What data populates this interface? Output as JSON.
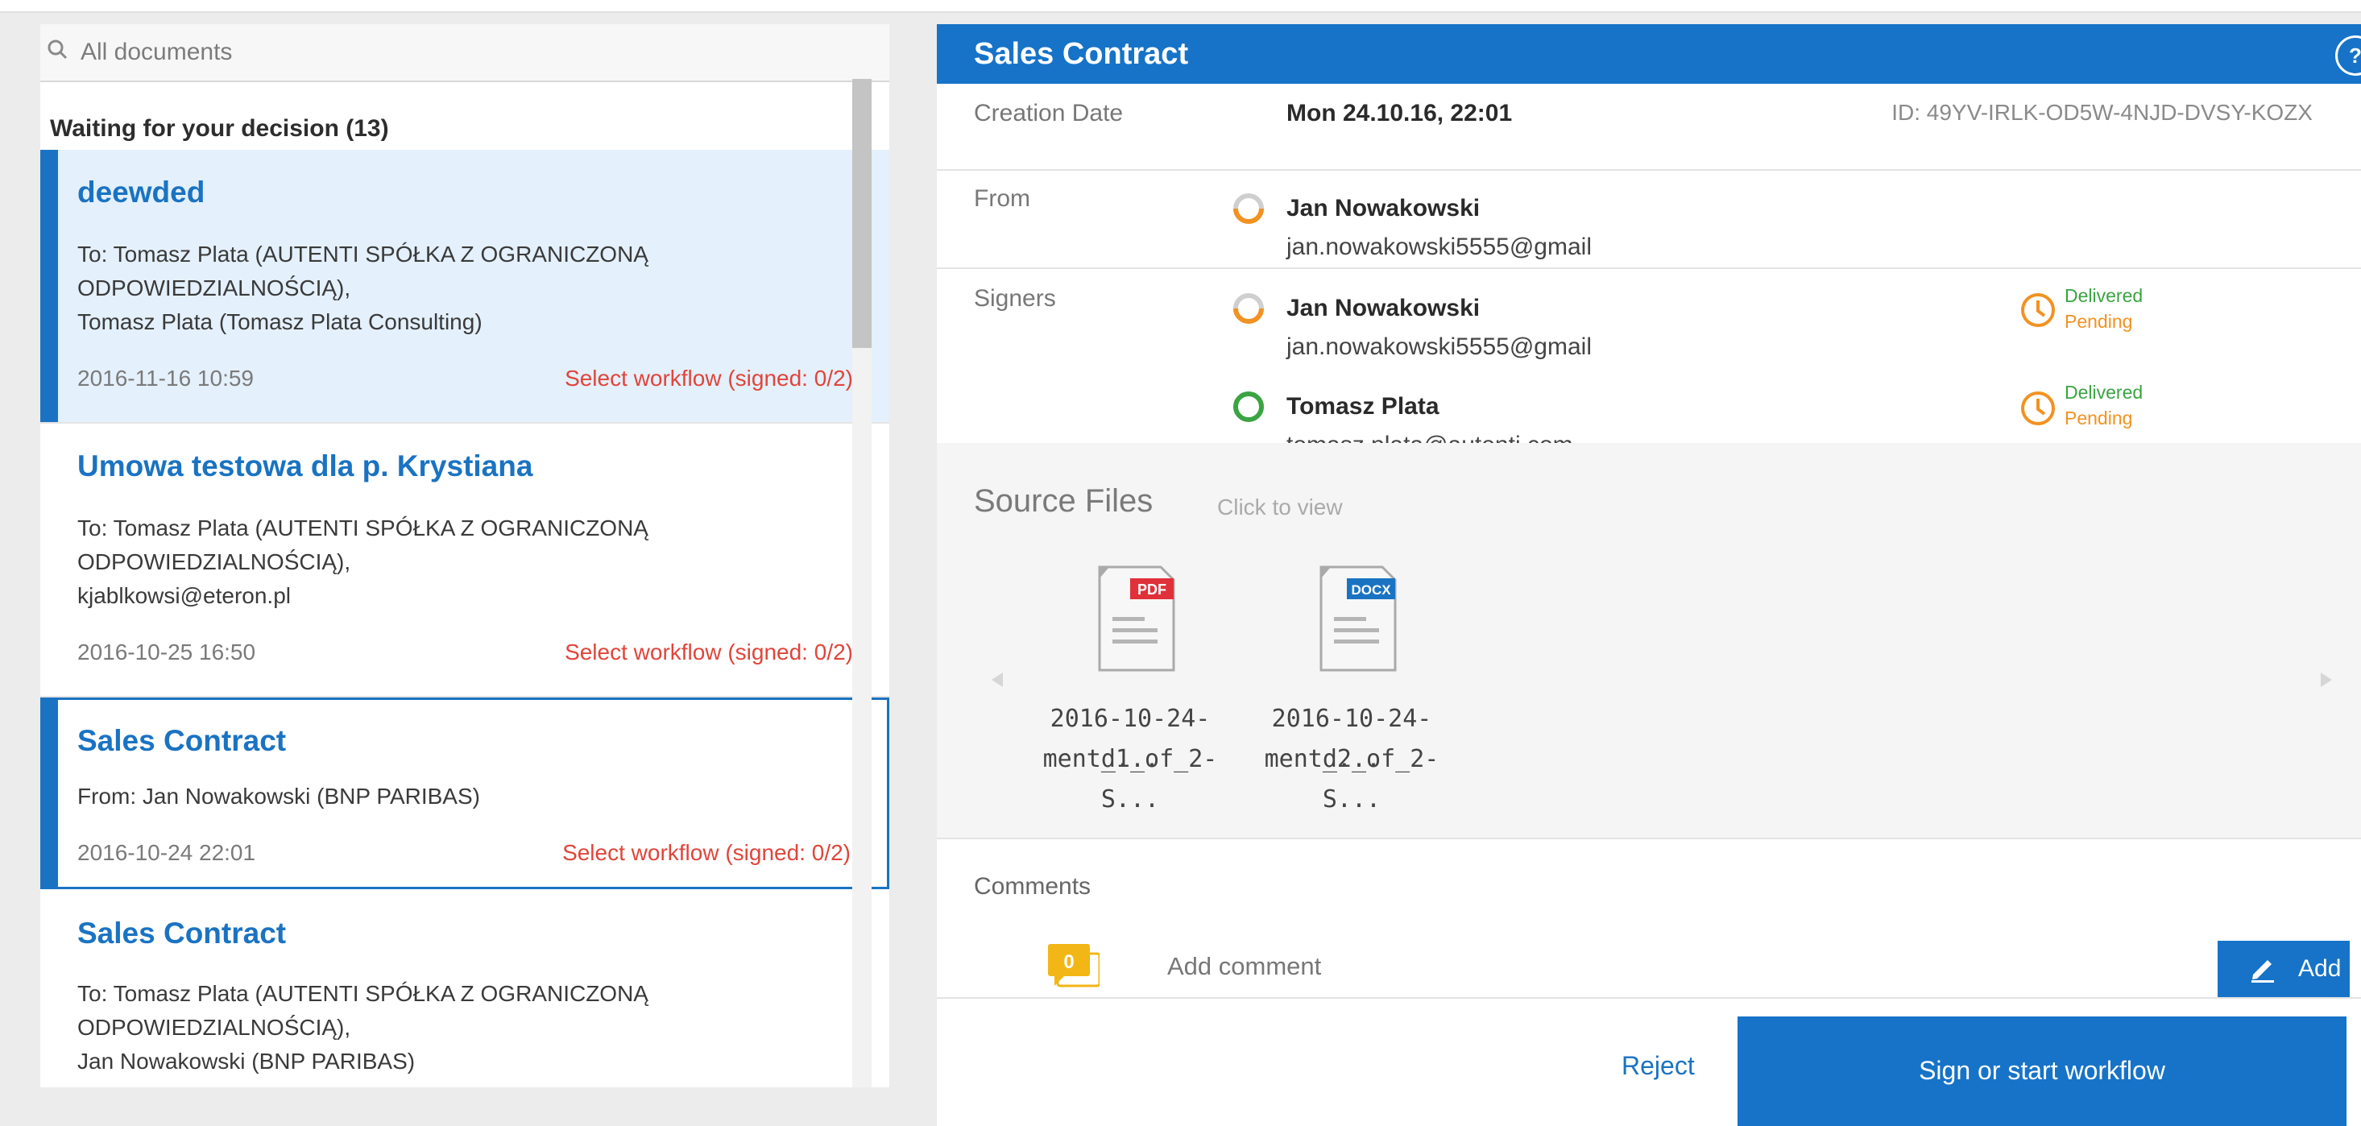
{
  "search": {
    "placeholder": "All documents"
  },
  "list": {
    "section_title": "Waiting for your decision (13)",
    "items": [
      {
        "title": "deewded",
        "lines": [
          "To: Tomasz Plata (AUTENTI SPÓŁKA Z OGRANICZONĄ",
          "ODPOWIEDZIALNOŚCIĄ),",
          "Tomasz Plata (Tomasz Plata Consulting)"
        ],
        "date": "2016-11-16 10:59",
        "status": "Select workflow (signed: 0/2)"
      },
      {
        "title": "Umowa testowa dla p. Krystiana",
        "lines": [
          "To: Tomasz Plata (AUTENTI SPÓŁKA Z OGRANICZONĄ",
          "ODPOWIEDZIALNOŚCIĄ),",
          "kjablkowsi@eteron.pl"
        ],
        "date": "2016-10-25 16:50",
        "status": "Select workflow (signed: 0/2)"
      },
      {
        "title": "Sales Contract",
        "lines": [
          "From: Jan Nowakowski (BNP PARIBAS)"
        ],
        "date": "2016-10-24 22:01",
        "status": "Select workflow (signed: 0/2)"
      },
      {
        "title": "Sales Contract",
        "lines": [
          "To: Tomasz Plata (AUTENTI SPÓŁKA Z OGRANICZONĄ",
          "ODPOWIEDZIALNOŚCIĄ),",
          "Jan Nowakowski (BNP PARIBAS)"
        ]
      }
    ]
  },
  "detail": {
    "title": "Sales Contract",
    "help": "?",
    "creation_label": "Creation Date",
    "creation_value": "Mon 24.10.16, 22:01",
    "id_text": "ID: 49YV-IRLK-OD5W-4NJD-DVSY-KOZX",
    "from_label": "From",
    "from_name": "Jan Nowakowski",
    "from_email": "jan.nowakowski5555@gmail",
    "signers_label": "Signers",
    "signers": [
      {
        "name": "Jan Nowakowski",
        "email": "jan.nowakowski5555@gmail",
        "status1": "Delivered",
        "status2": "Pending"
      },
      {
        "name": "Tomasz Plata",
        "email": "tomasz.plata@autenti.com",
        "status1": "Delivered",
        "status2": "Pending"
      }
    ],
    "source_files_label": "Source Files",
    "click_to_view": "Click to view",
    "files": [
      {
        "type": "PDF",
        "name1": "2016-10-24-d...",
        "name2": "ment_1_of_2-S..."
      },
      {
        "type": "DOCX",
        "name1": "2016-10-24-d...",
        "name2": "ment_2_of_2-S..."
      }
    ],
    "comments_label": "Comments",
    "comment_count": "0",
    "add_comment_placeholder": "Add comment",
    "add_label": "Add",
    "reject_label": "Reject",
    "sign_label": "Sign or start workflow"
  },
  "colors": {
    "accent": "#1673c8",
    "status_red": "#e0453a",
    "delivered": "#3aa442",
    "pending": "#f29221",
    "pdf": "#e0303a",
    "docx": "#1a73c2",
    "badge": "#f2b616"
  },
  "icons": [
    "search-icon",
    "help-icon",
    "progress-ring-icon",
    "clock-icon",
    "pdf-file-icon",
    "docx-file-icon",
    "chevron-left-icon",
    "chevron-right-icon",
    "comment-badge-icon",
    "pencil-icon"
  ]
}
